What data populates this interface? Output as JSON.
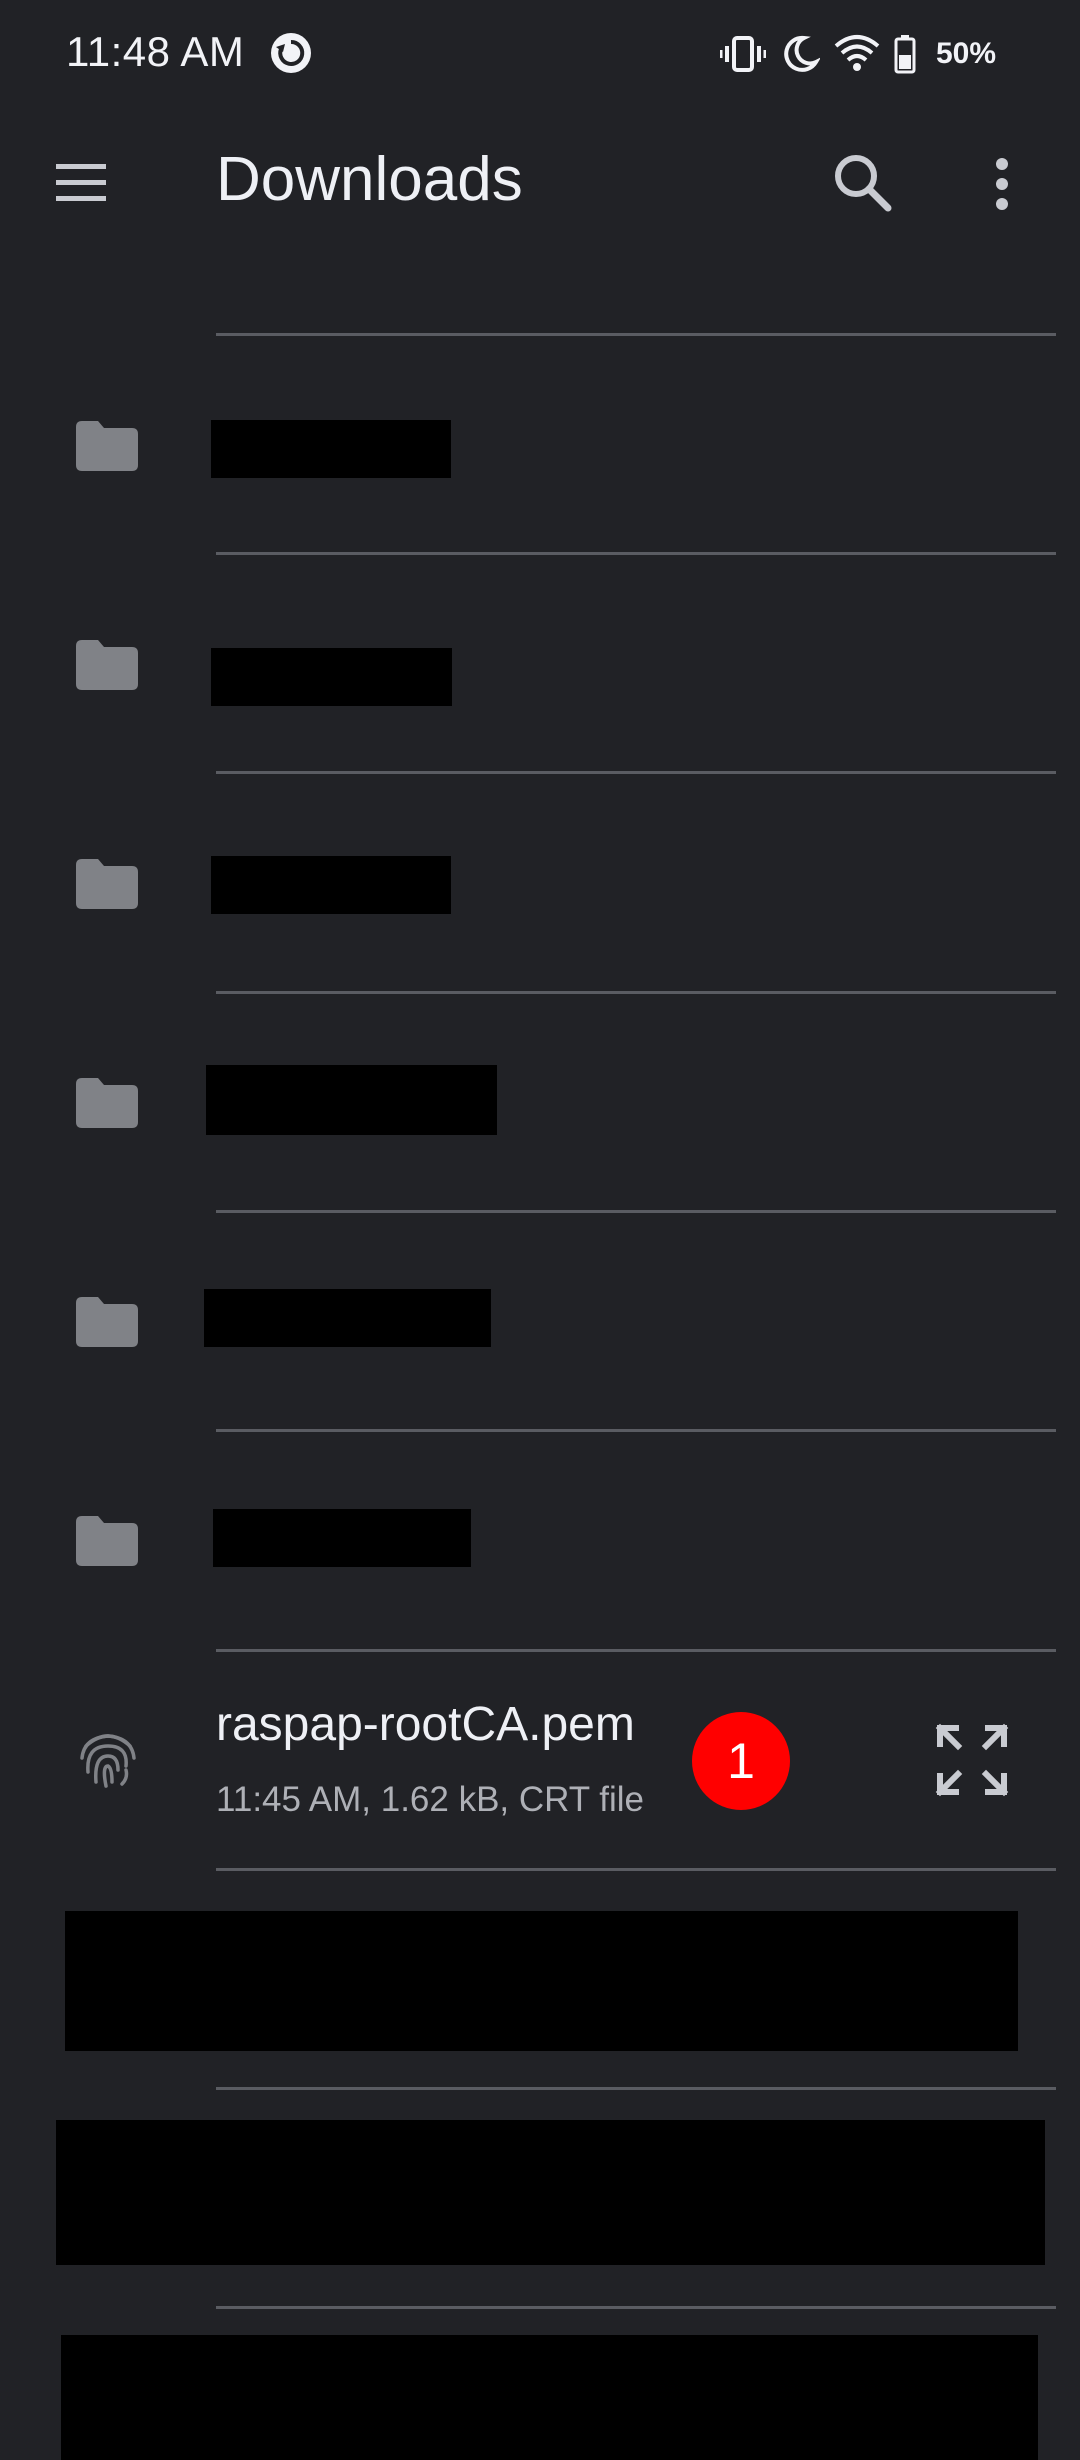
{
  "status_bar": {
    "time": "11:48 AM",
    "battery_percent": "50%",
    "icons": [
      "sync-icon",
      "vibrate-icon",
      "dnd-moon-icon",
      "wifi-icon",
      "battery-icon"
    ]
  },
  "app_bar": {
    "title": "Downloads",
    "icons": [
      "menu-icon",
      "search-icon",
      "more-vert-icon"
    ]
  },
  "file": {
    "name": "raspap-rootCA.pem",
    "meta": "11:45 AM, 1.62 kB, CRT file",
    "badge": "1",
    "icon": "fingerprint-icon"
  },
  "colors": {
    "background": "#212226",
    "divider": "#5a5c62",
    "folder": "#808287",
    "badge": "#ff0000"
  }
}
